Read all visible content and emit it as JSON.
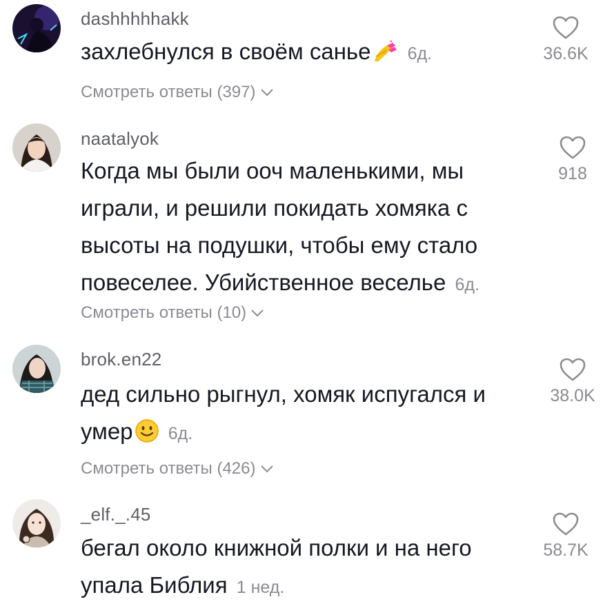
{
  "comments": [
    {
      "username": "dashhhhhakk",
      "text": "захлебнулся в своём санье",
      "emoji": "nail-polish-emoji",
      "time": "6д.",
      "likes": "36.6K",
      "replies": "Смотреть ответы (397)"
    },
    {
      "username": "naatalyok",
      "text": "Когда мы были ооч маленькими, мы играли, и решили покидать хомяка с высоты на подушки, чтобы ему стало повеселее. Убийственное веселье",
      "time": "6д.",
      "likes": "918",
      "replies": "Смотреть ответы (10)"
    },
    {
      "username": "brok.en22",
      "text": "дед сильно рыгнул, хомяк испугался и умер",
      "emoji": "slightly-smiling-face-emoji",
      "time": "6д.",
      "likes": "38.0K",
      "replies": "Смотреть ответы (426)"
    },
    {
      "username": "_elf._.45",
      "text": "бегал около книжной полки и на него упала Библия",
      "time": "1 нед.",
      "likes": "58.7K"
    }
  ],
  "icons": {
    "like": "heart-outline-icon",
    "expand": "chevron-down-icon"
  },
  "colors": {
    "text": "#161823",
    "secondary": "#8a8b91"
  }
}
